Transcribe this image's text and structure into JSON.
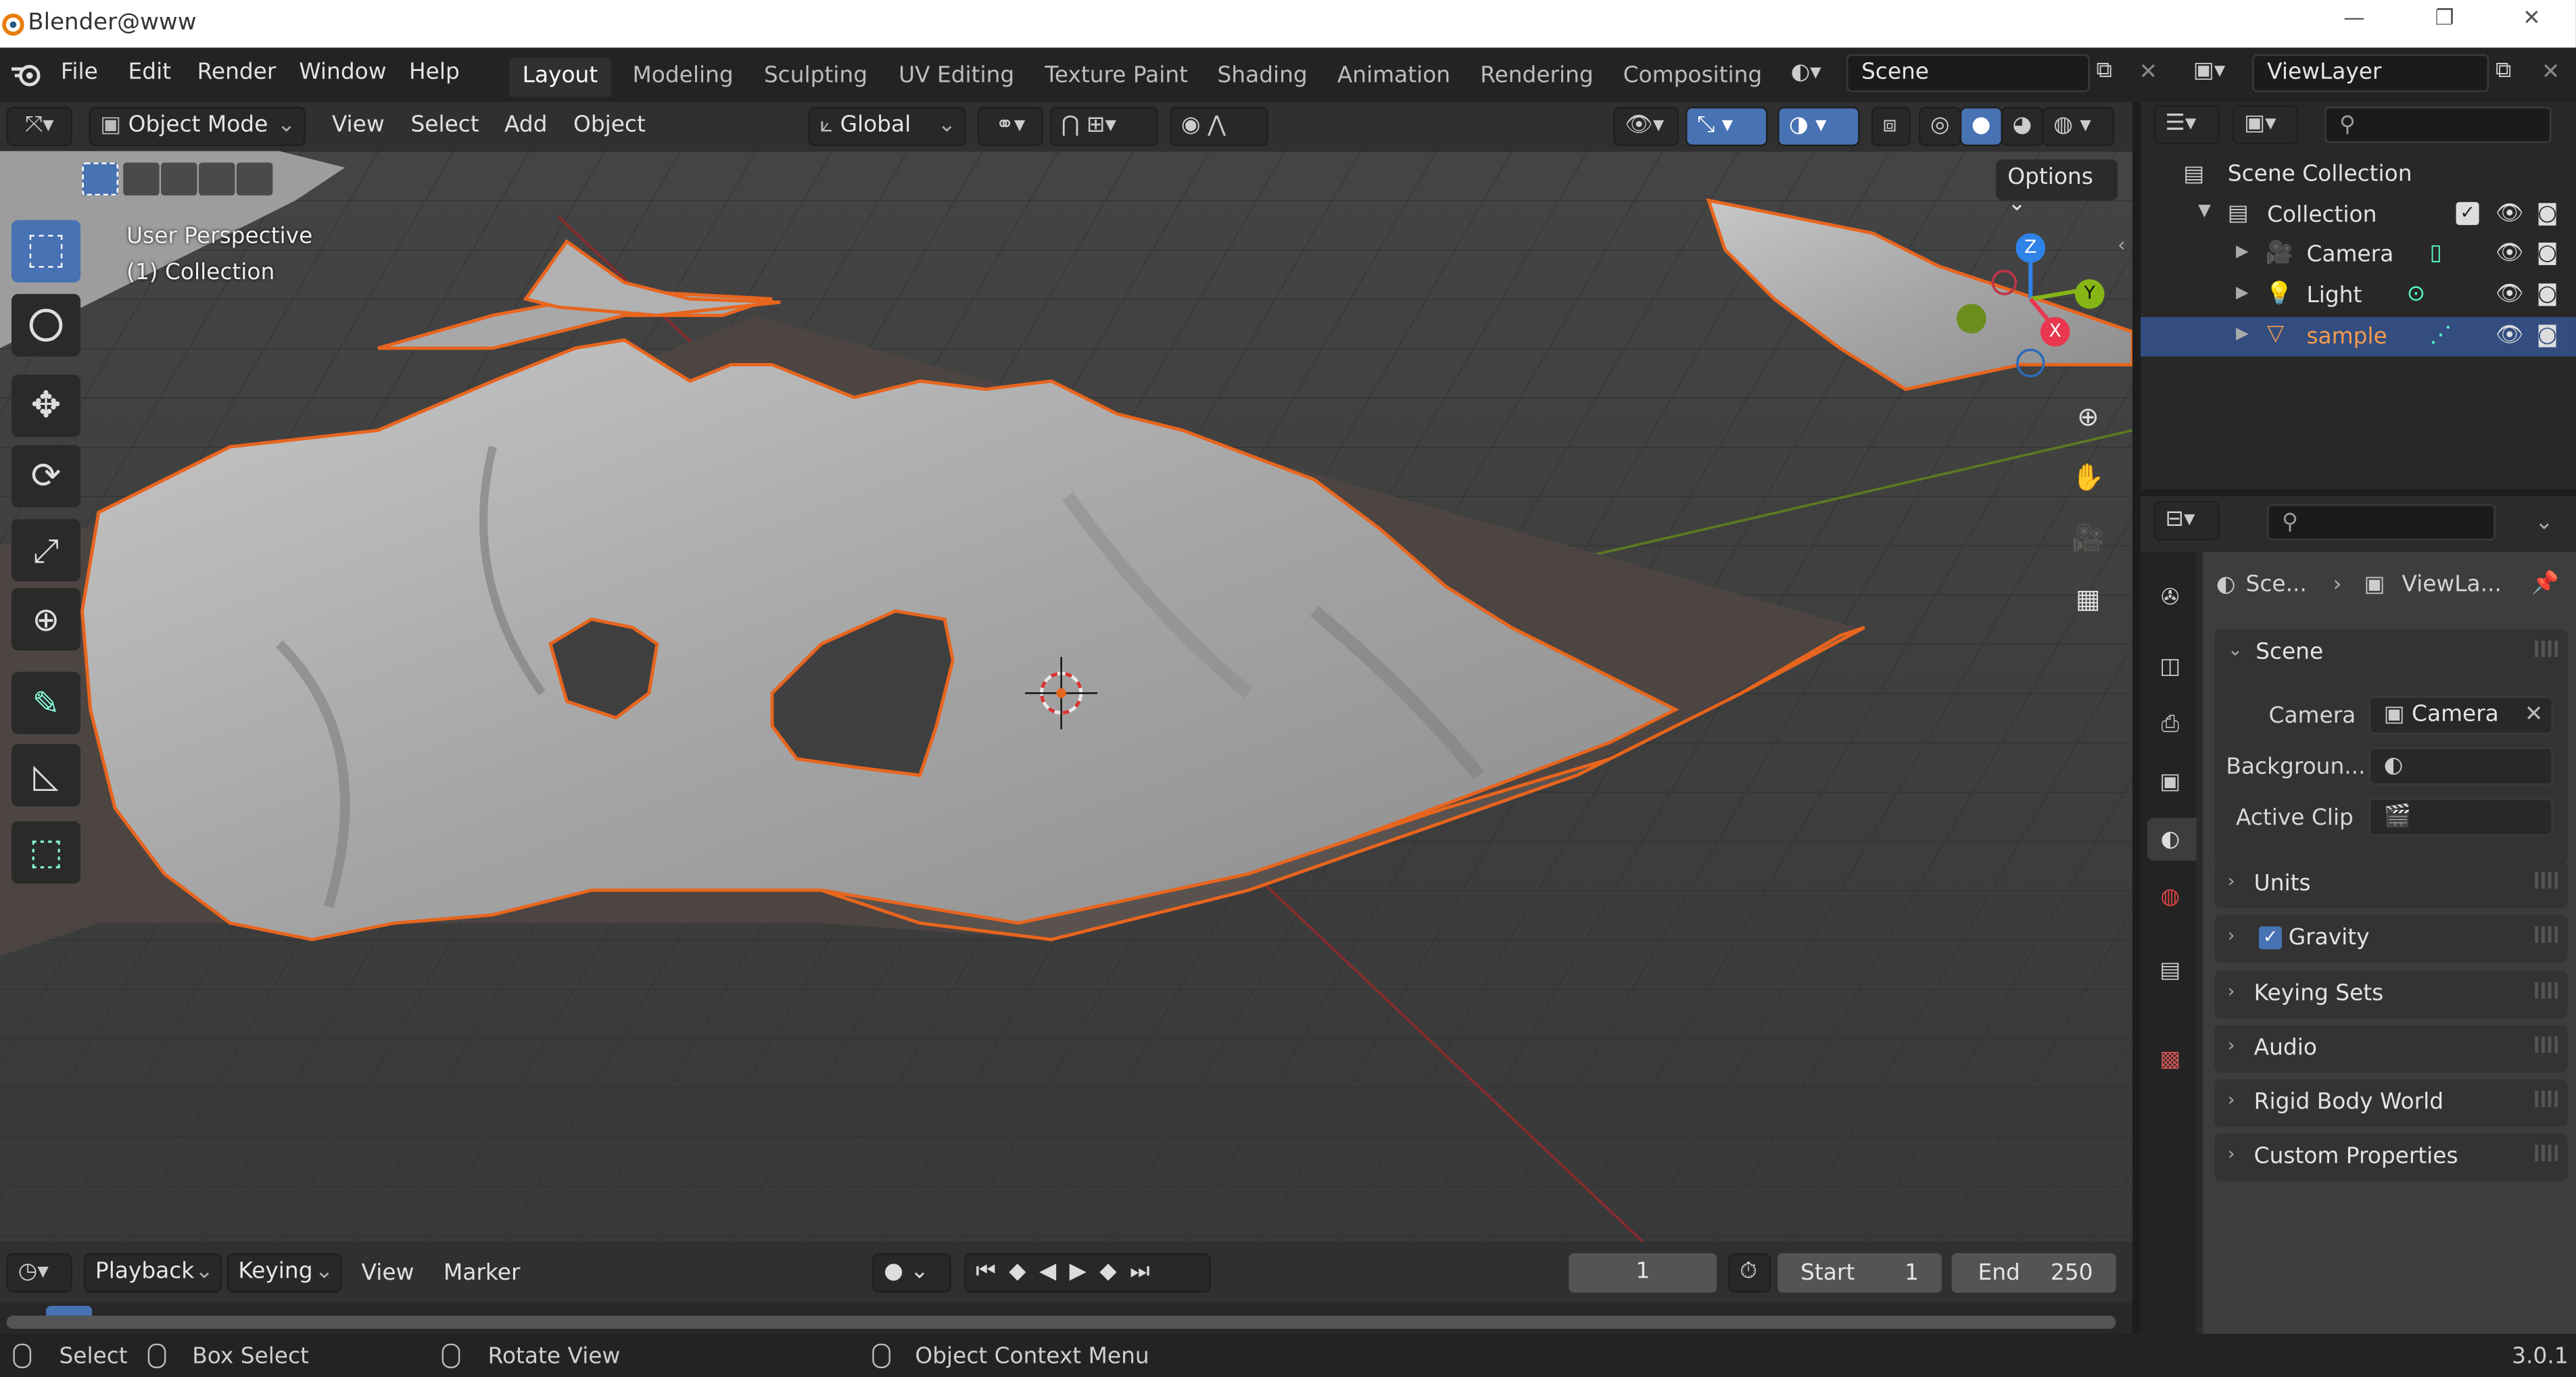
{
  "window": {
    "title": "Blender@www"
  },
  "menus": [
    "File",
    "Edit",
    "Render",
    "Window",
    "Help"
  ],
  "workspaces": [
    "Layout",
    "Modeling",
    "Sculpting",
    "UV Editing",
    "Texture Paint",
    "Shading",
    "Animation",
    "Rendering",
    "Compositing"
  ],
  "scene_field": "Scene",
  "viewlayer_field": "ViewLayer",
  "viewport_header": {
    "mode": "Object Mode",
    "menus": [
      "View",
      "Select",
      "Add",
      "Object"
    ],
    "orientation": "Global",
    "options": "Options"
  },
  "viewport": {
    "perspective": "User Perspective",
    "collection": "(1) Collection",
    "gizmo": {
      "x": "X",
      "y": "Y",
      "z": "Z"
    }
  },
  "outliner": {
    "items": [
      {
        "label": "Scene Collection"
      },
      {
        "label": "Collection"
      },
      {
        "label": "Camera"
      },
      {
        "label": "Light"
      },
      {
        "label": "sample"
      }
    ]
  },
  "properties": {
    "breadcrumb": {
      "scene": "Sce...",
      "layer": "ViewLa..."
    },
    "scene_panel": "Scene",
    "camera_label": "Camera",
    "camera_value": "Camera",
    "background_label": "Backgroun...",
    "clip_label": "Active Clip",
    "panels": [
      "Units",
      "Gravity",
      "Keying Sets",
      "Audio",
      "Rigid Body World",
      "Custom Properties"
    ]
  },
  "timeline": {
    "menus": [
      "Playback",
      "Keying",
      "View",
      "Marker"
    ],
    "current_frame": "1",
    "start_label": "Start",
    "start": "1",
    "end_label": "End",
    "end": "250"
  },
  "status": {
    "select": "Select",
    "box_select": "Box Select",
    "rotate": "Rotate View",
    "context": "Object Context Menu",
    "version": "3.0.1"
  },
  "colors": {
    "accent": "#4772b3",
    "selection_outline": "#e8651e",
    "viewport_bg": "#3d3d3d",
    "axis_x": "#e8374f",
    "axis_y": "#86b516",
    "axis_z": "#2f82e8"
  }
}
